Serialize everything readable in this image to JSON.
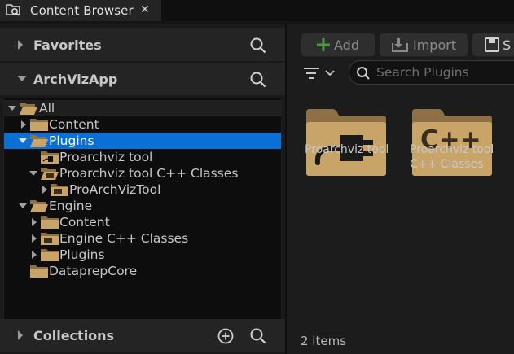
{
  "tab": {
    "title": "Content Browser",
    "close": "✕"
  },
  "sidebar": {
    "favorites_label": "Favorites",
    "project_label": "ArchVizApp",
    "collections_label": "Collections"
  },
  "tree": {
    "all": "All",
    "content": "Content",
    "plugins": "Plugins",
    "proarchviz_tool": "Proarchviz tool",
    "proarchviz_cpp": "Proarchviz tool C++ Classes",
    "proarchviztool_module": "ProArchVizTool",
    "engine": "Engine",
    "engine_content": "Content",
    "engine_cpp": "Engine C++ Classes",
    "engine_plugins": "Plugins",
    "dataprep_core": "DataprepCore"
  },
  "toolbar": {
    "add_label": "Add",
    "import_label": "Import",
    "save_label": "S"
  },
  "search": {
    "placeholder": "Search Plugins"
  },
  "tiles": [
    {
      "line1": "Proarchviz tool",
      "line2": ""
    },
    {
      "line1": "Proarchviz tool",
      "line2": "C++ Classes",
      "badge": "C++"
    }
  ],
  "status": {
    "items_count": "2 items"
  },
  "colors": {
    "selection": "#0b70d6",
    "folder": "#c9a468",
    "folder_dark": "#8d7046"
  }
}
